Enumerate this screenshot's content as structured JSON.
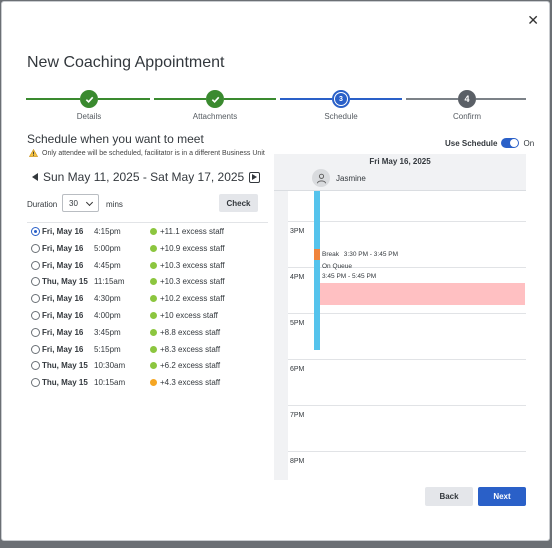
{
  "dialog": {
    "title": "New Coaching Appointment",
    "close_icon": "close-icon"
  },
  "stepper": {
    "steps": [
      {
        "label": "Details",
        "state": "complete",
        "icon": "check-icon"
      },
      {
        "label": "Attachments",
        "state": "complete",
        "icon": "check-icon"
      },
      {
        "label": "Schedule",
        "state": "current",
        "number": "3"
      },
      {
        "label": "Confirm",
        "state": "upcoming",
        "number": "4"
      }
    ],
    "colors": {
      "complete": "#3a8a2f",
      "current": "#2a60c8",
      "upcoming": "#5a5f66"
    }
  },
  "schedule": {
    "heading": "Schedule when you want to meet",
    "warning": "Only attendee will be scheduled, facilitator is in a different Business Unit",
    "use_schedule_label": "Use Schedule",
    "use_schedule_state": "On",
    "week_range": "Sun May 11, 2025 - Sat May 17, 2025",
    "duration_label": "Duration",
    "duration_value": "30",
    "duration_unit": "mins",
    "check_label": "Check",
    "slots": [
      {
        "day": "Fri, May 16",
        "time": "4:15pm",
        "staff": "+11.1 excess staff",
        "selected": true,
        "color": "#8cc63f"
      },
      {
        "day": "Fri, May 16",
        "time": "5:00pm",
        "staff": "+10.9 excess staff",
        "selected": false,
        "color": "#8cc63f"
      },
      {
        "day": "Fri, May 16",
        "time": "4:45pm",
        "staff": "+10.3 excess staff",
        "selected": false,
        "color": "#8cc63f"
      },
      {
        "day": "Thu, May 15",
        "time": "11:15am",
        "staff": "+10.3 excess staff",
        "selected": false,
        "color": "#8cc63f"
      },
      {
        "day": "Fri, May 16",
        "time": "4:30pm",
        "staff": "+10.2 excess staff",
        "selected": false,
        "color": "#8cc63f"
      },
      {
        "day": "Fri, May 16",
        "time": "4:00pm",
        "staff": "+10 excess staff",
        "selected": false,
        "color": "#8cc63f"
      },
      {
        "day": "Fri, May 16",
        "time": "3:45pm",
        "staff": "+8.8 excess staff",
        "selected": false,
        "color": "#8cc63f"
      },
      {
        "day": "Fri, May 16",
        "time": "5:15pm",
        "staff": "+8.3 excess staff",
        "selected": false,
        "color": "#8cc63f"
      },
      {
        "day": "Thu, May 15",
        "time": "10:30am",
        "staff": "+6.2 excess staff",
        "selected": false,
        "color": "#8cc63f"
      },
      {
        "day": "Thu, May 15",
        "time": "10:15am",
        "staff": "+4.3 excess staff",
        "selected": false,
        "color": "#f5a623"
      }
    ]
  },
  "calendar": {
    "date": "Fri May 16, 2025",
    "person": "Jasmine",
    "hours": [
      "3PM",
      "4PM",
      "5PM",
      "6PM",
      "7PM",
      "8PM"
    ],
    "events": {
      "break_label": "Break",
      "break_time": "3:30 PM - 3:45 PM",
      "queue_label": "On Queue",
      "queue_time": "3:45 PM - 5:45 PM"
    },
    "colors": {
      "queue": "#55c3ec",
      "break": "#f0843c",
      "appointment": "#ffc0c2"
    }
  },
  "footer": {
    "back_label": "Back",
    "next_label": "Next"
  }
}
